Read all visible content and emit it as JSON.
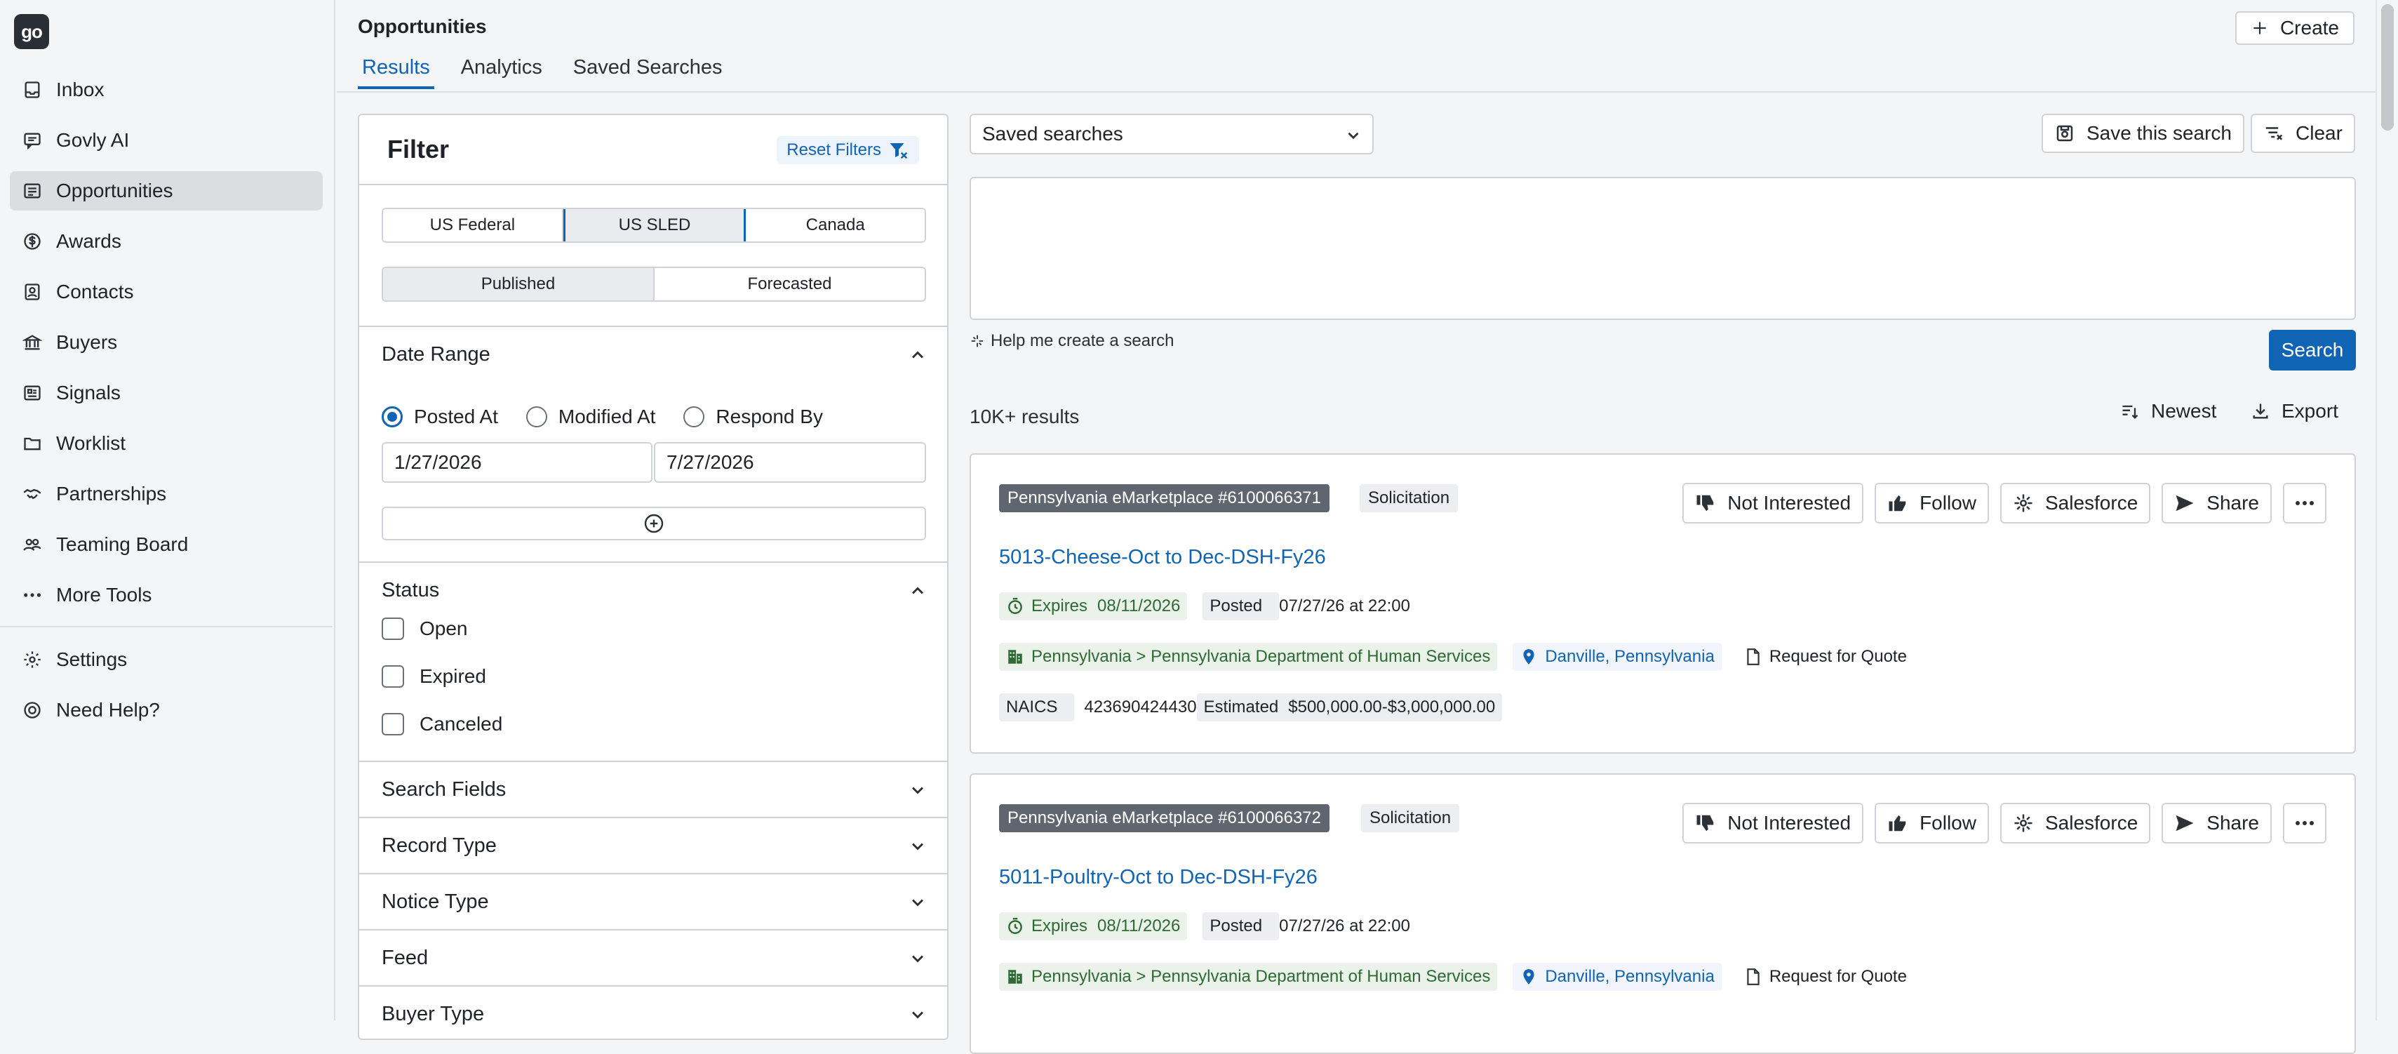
{
  "app": {
    "logo_text": "go"
  },
  "sidebar": {
    "items": [
      {
        "label": "Inbox",
        "icon": "inbox-icon"
      },
      {
        "label": "Govly AI",
        "icon": "chat-icon"
      },
      {
        "label": "Opportunities",
        "icon": "list-icon",
        "active": true
      },
      {
        "label": "Awards",
        "icon": "dollar-icon"
      },
      {
        "label": "Contacts",
        "icon": "contact-icon"
      },
      {
        "label": "Buyers",
        "icon": "bank-icon"
      },
      {
        "label": "Signals",
        "icon": "signal-icon"
      },
      {
        "label": "Worklist",
        "icon": "folder-icon"
      },
      {
        "label": "Partnerships",
        "icon": "handshake-icon"
      },
      {
        "label": "Teaming Board",
        "icon": "people-icon"
      },
      {
        "label": "More Tools",
        "icon": "more-icon"
      }
    ],
    "bottom_items": [
      {
        "label": "Settings",
        "icon": "gear-icon"
      },
      {
        "label": "Need Help?",
        "icon": "help-icon"
      }
    ]
  },
  "header": {
    "title": "Opportunities",
    "create_label": "Create",
    "tabs": [
      {
        "label": "Results",
        "active": true
      },
      {
        "label": "Analytics"
      },
      {
        "label": "Saved Searches"
      }
    ]
  },
  "filter": {
    "title": "Filter",
    "reset_label": "Reset Filters",
    "regions": [
      "US Federal",
      "US SLED",
      "Canada"
    ],
    "selected_region": "US SLED",
    "publish_states": [
      "Published",
      "Forecasted"
    ],
    "selected_publish_state": "Published",
    "date_range": {
      "label": "Date Range",
      "options": [
        "Posted At",
        "Modified At",
        "Respond By"
      ],
      "selected": "Posted At",
      "from": "1/27/2026",
      "to": "7/27/2026"
    },
    "status": {
      "label": "Status",
      "options": [
        "Open",
        "Expired",
        "Canceled"
      ]
    },
    "collapsed_sections": [
      "Search Fields",
      "Record Type",
      "Notice Type",
      "Feed",
      "Buyer Type"
    ]
  },
  "search": {
    "saved_searches_label": "Saved searches",
    "save_label": "Save this search",
    "clear_label": "Clear",
    "query": "",
    "help_label": "Help me create a search",
    "search_label": "Search"
  },
  "results": {
    "count_label": "10K+ results",
    "sort_label": "Newest",
    "export_label": "Export",
    "action_labels": {
      "not_interested": "Not Interested",
      "follow": "Follow",
      "salesforce": "Salesforce",
      "share": "Share"
    },
    "items": [
      {
        "source": "Pennsylvania eMarketplace #6100066371",
        "type": "Solicitation",
        "title": "5013-Cheese-Oct to Dec-DSH-Fy26",
        "expires_label": "Expires",
        "expires": "08/11/2026",
        "posted_label": "Posted",
        "posted": "07/27/26 at 22:00",
        "agency": "Pennsylvania > Pennsylvania Department of Human Services",
        "location": "Danville, Pennsylvania",
        "doc_type": "Request for Quote",
        "naics_label": "NAICS",
        "naics": [
          "423690",
          "424430"
        ],
        "estimated_label": "Estimated",
        "estimated": "$500,000.00-$3,000,000.00"
      },
      {
        "source": "Pennsylvania eMarketplace #6100066372",
        "type": "Solicitation",
        "title": "5011-Poultry-Oct to Dec-DSH-Fy26",
        "expires_label": "Expires",
        "expires": "08/11/2026",
        "posted_label": "Posted",
        "posted": "07/27/26 at 22:00",
        "agency": "Pennsylvania > Pennsylvania Department of Human Services",
        "location": "Danville, Pennsylvania",
        "doc_type": "Request for Quote"
      }
    ]
  },
  "colors": {
    "accent": "#0f65b4",
    "source_badge": "#5f6670",
    "expires_green": "#2e6b34"
  }
}
